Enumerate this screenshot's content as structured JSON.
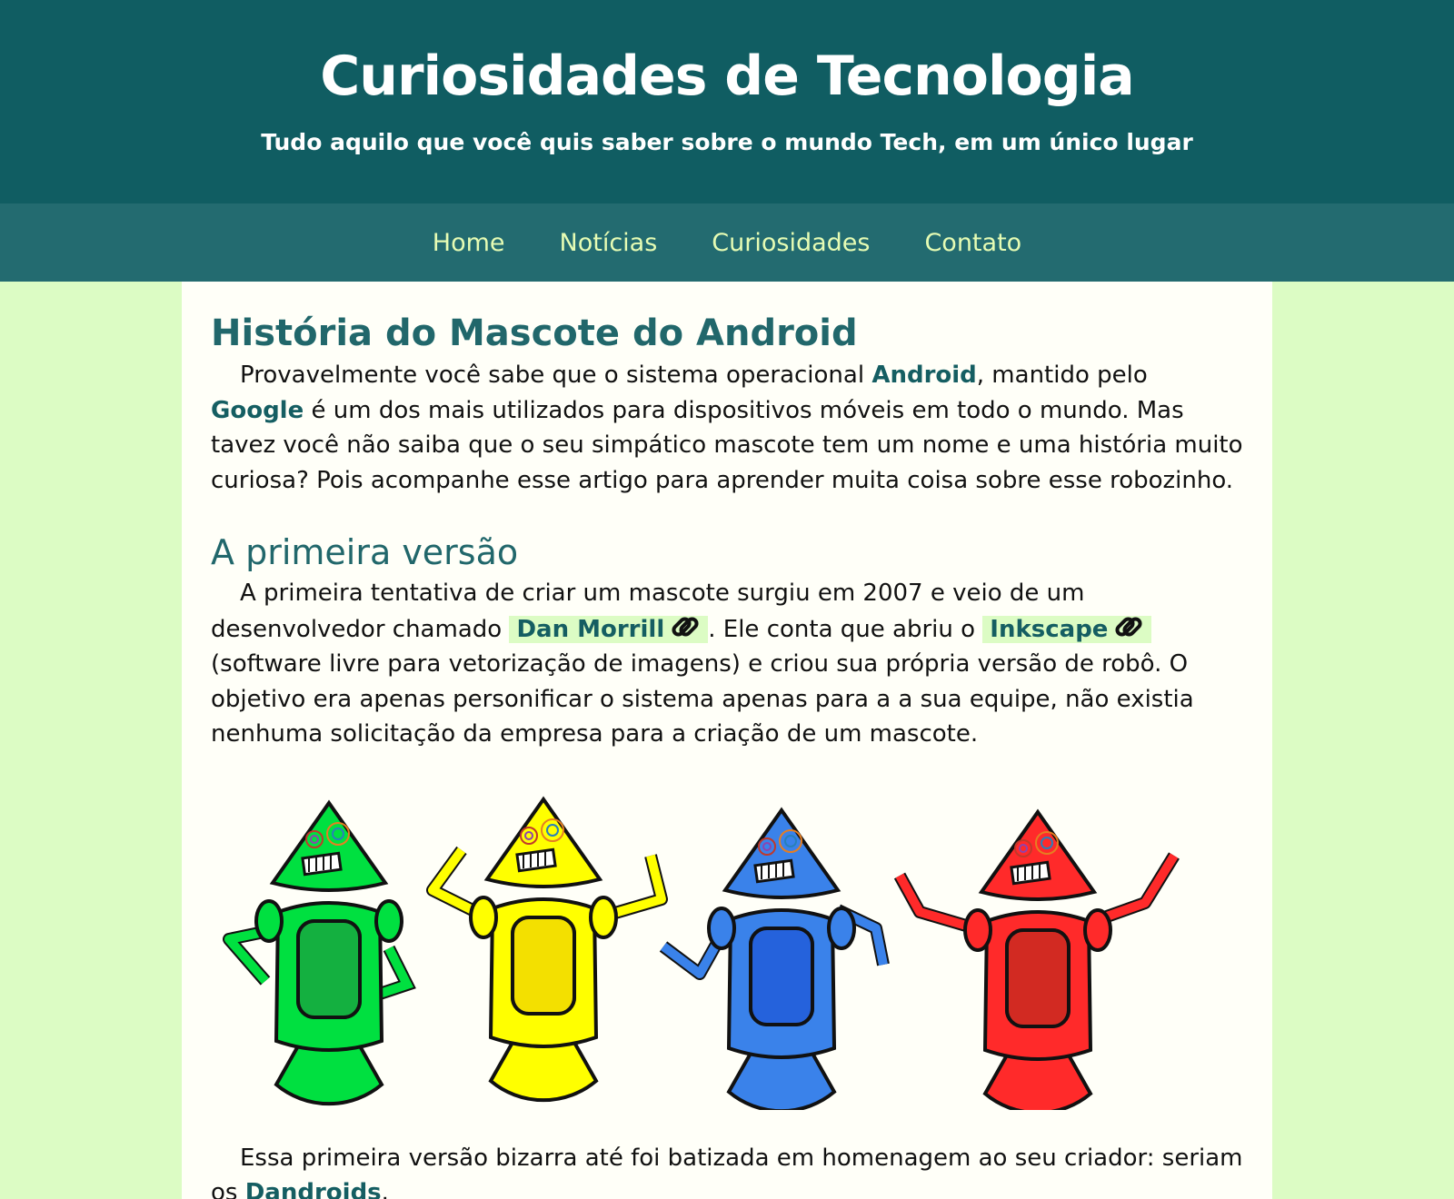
{
  "header": {
    "title": "Curiosidades de Tecnologia",
    "subtitle": "Tudo aquilo que você quis saber sobre o mundo Tech, em um único lugar"
  },
  "nav": {
    "items": [
      {
        "label": "Home"
      },
      {
        "label": "Notícias"
      },
      {
        "label": "Curiosidades"
      },
      {
        "label": "Contato"
      }
    ]
  },
  "article": {
    "title": "História do Mascote do Android",
    "intro": {
      "t1": "Provavelmente você sabe que o sistema operacional ",
      "android": "Android",
      "t2": ", mantido pelo ",
      "google": "Google",
      "t3": " é um dos mais utilizados para dispositivos móveis em todo o mundo. Mas tavez você não saiba que o seu simpático mascote tem um nome e uma história muito curiosa? Pois acompanhe esse artigo para aprender muita coisa sobre esse robozinho."
    },
    "section1": {
      "title": "A primeira versão",
      "p1": {
        "t1": "A primeira tentativa de criar um mascote surgiu em 2007 e veio de um desenvolvedor chamado ",
        "link1": "Dan Morrill",
        "t2": ". Ele conta que abriu o ",
        "link2": "Inkscape",
        "t3": " (software livre para vetorização de imagens) e criou sua própria versão de robô. O objetivo era apenas personificar o sistema apenas para a a sua equipe, não existia nenhuma solicitação da empresa para a criação de um mascote."
      },
      "robots": {
        "colors": [
          "#00e040",
          "#ffff00",
          "#3a82ea",
          "#ff2a2a"
        ],
        "body_colors": [
          "#14b040",
          "#f3e000",
          "#2562dc",
          "#d22a22"
        ]
      },
      "p2": {
        "t1": "Essa primeira versão bizarra até foi batizada em homenagem ao seu criador: seriam os ",
        "link": "Dandroids",
        "t2": "."
      }
    }
  },
  "icons": {
    "external_link": "chain-link-icon"
  }
}
